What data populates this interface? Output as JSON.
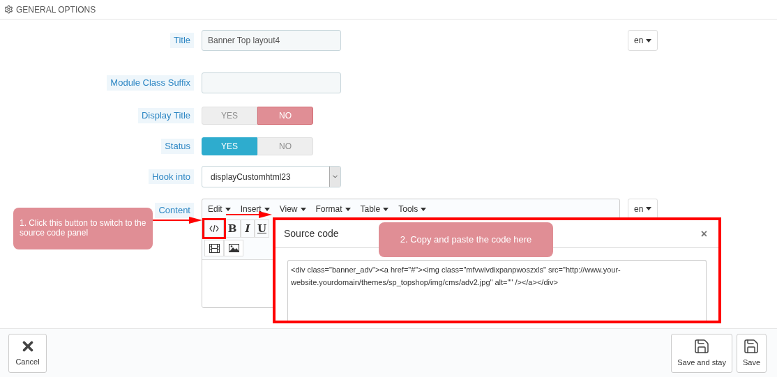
{
  "header": {
    "title": "GENERAL OPTIONS"
  },
  "title_field": {
    "label": "Title",
    "value": "Banner Top layout4",
    "lang": "en"
  },
  "suffix_field": {
    "label": "Module Class Suffix"
  },
  "display_title": {
    "label": "Display Title",
    "options": [
      {
        "label": "YES",
        "kind": "yes",
        "selected": false
      },
      {
        "label": "NO",
        "kind": "no",
        "selected": true
      }
    ]
  },
  "status": {
    "label": "Status",
    "options": [
      {
        "label": "YES",
        "kind": "yes",
        "selected": true
      },
      {
        "label": "NO",
        "kind": "no",
        "selected": false
      }
    ]
  },
  "hook_into": {
    "label": "Hook into",
    "value": "displayCustomhtml23"
  },
  "content": {
    "label": "Content",
    "lang": "en",
    "menu": [
      "Edit",
      "Insert",
      "View",
      "Format",
      "Table",
      "Tools"
    ],
    "toolbar": [
      {
        "kind": "code"
      },
      {
        "kind": "bold",
        "label": "B"
      },
      {
        "kind": "italic",
        "label": "I"
      },
      {
        "kind": "underline",
        "label": "U"
      }
    ],
    "toolbar_2": [
      {
        "kind": "media"
      },
      {
        "kind": "image"
      }
    ]
  },
  "dialog": {
    "title": "Source code",
    "close": "×",
    "code": "<div class=\"banner_adv\"><a href=\"#\"><img class=\"mfvwivdixpanpwoszxls\" src=\"http://www.your-website.yourdomain/themes/sp_topshop/img/cms/adv2.jpg\" alt=\"\" /></a></div>"
  },
  "annotations": [
    "1. Click this button to switch to the source code panel",
    "2. Copy and paste the code here"
  ],
  "footer": {
    "left": [
      {
        "label": "Cancel",
        "kind": "cancel"
      }
    ],
    "right": [
      {
        "label": "Save and stay",
        "kind": "save"
      },
      {
        "label": "Save",
        "kind": "save"
      }
    ]
  }
}
